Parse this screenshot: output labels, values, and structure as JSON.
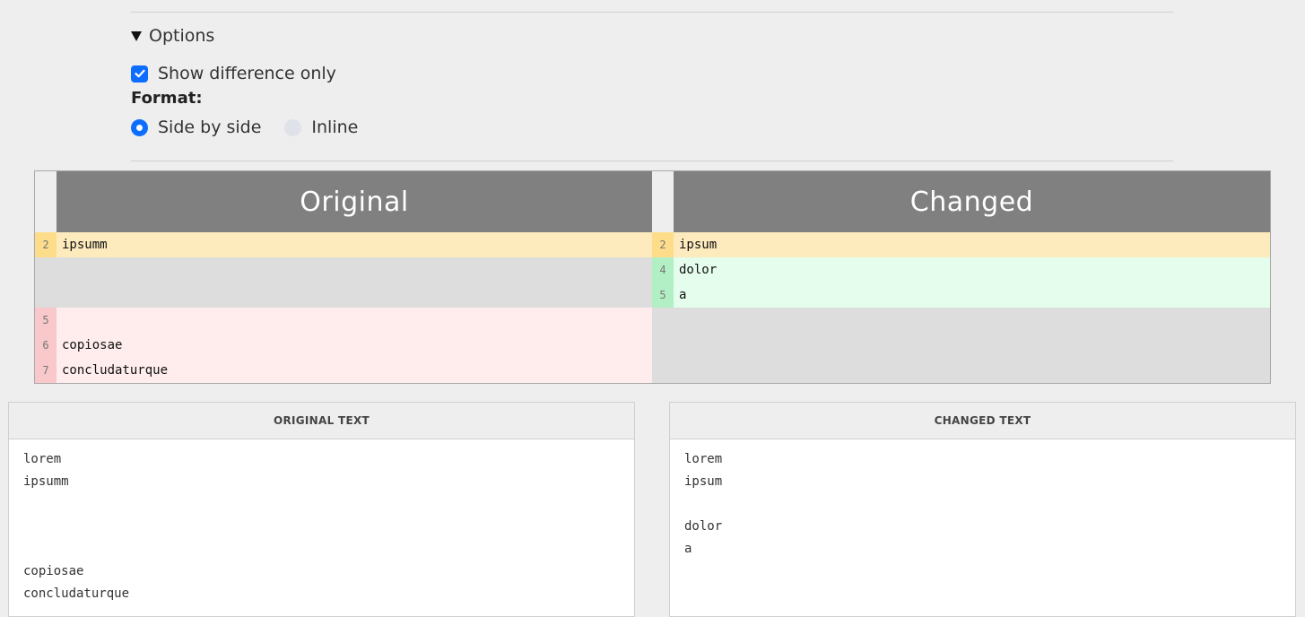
{
  "options": {
    "summary_label": "Options",
    "show_difference_only_label": "Show difference only",
    "show_difference_only_checked": true,
    "format_label": "Format:",
    "format_options": [
      {
        "label": "Side by side",
        "selected": true
      },
      {
        "label": "Inline",
        "selected": false
      }
    ]
  },
  "diff": {
    "original_header": "Original",
    "changed_header": "Changed",
    "rows": [
      {
        "left": {
          "line": "2",
          "text": "ipsumm",
          "kind": "modified"
        },
        "right": {
          "line": "2",
          "text": "ipsum",
          "kind": "modified"
        }
      },
      {
        "left": null,
        "right": {
          "line": "4",
          "text": "dolor",
          "kind": "added"
        }
      },
      {
        "left": null,
        "right": {
          "line": "5",
          "text": "a",
          "kind": "added"
        }
      },
      {
        "left": {
          "line": "5",
          "text": "",
          "kind": "removed"
        },
        "right": null
      },
      {
        "left": {
          "line": "6",
          "text": "copiosae",
          "kind": "removed"
        },
        "right": null
      },
      {
        "left": {
          "line": "7",
          "text": "concludaturque",
          "kind": "removed"
        },
        "right": null
      }
    ]
  },
  "original_panel": {
    "title": "ORIGINAL TEXT",
    "content": "lorem\nipsumm\n\n\n\ncopiosae\nconcludaturque"
  },
  "changed_panel": {
    "title": "CHANGED TEXT",
    "content": "lorem\nipsum\n\ndolor\na"
  },
  "colors": {
    "accent": "#0d6efd",
    "modified_gutter": "#fddd8a",
    "modified_bg": "#fdebbd",
    "added_gutter": "#b3efc4",
    "added_bg": "#e4fdec",
    "removed_gutter": "#f8c8cb",
    "removed_bg": "#ffeced",
    "header_bg": "#808080"
  }
}
